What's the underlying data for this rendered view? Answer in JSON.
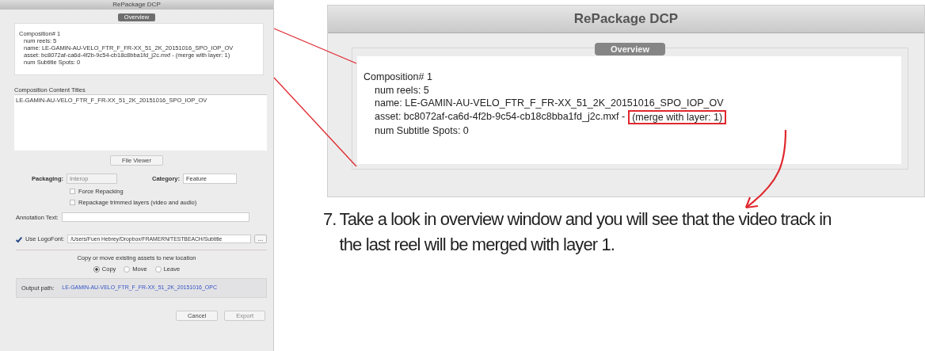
{
  "left_dialog": {
    "title": "RePackage DCP",
    "tab": {
      "label": "Overview",
      "selected": true
    },
    "composition": {
      "title": "Composition# 1",
      "children": [
        {
          "text": "num reels:  5"
        },
        {
          "text": "name:  LE-GAMIN-AU-VELO_FTR_F_FR-XX_51_2K_20151016_SPO_IOP_OV"
        },
        {
          "text": "asset: bc8072af-ca6d-4f2b-9c54-cb18c8bba1fd_j2c.mxf - (merge with layer: 1)"
        },
        {
          "text": "num Subtitle Spots: 0"
        }
      ]
    },
    "content_titles": {
      "heading": "Composition Content Titles",
      "items": [
        "LE-GAMIN-AU-VELO_FTR_F_FR-XX_51_2K_20151016_SPO_IOP_OV"
      ]
    },
    "file_viewer_button": "File Viewer",
    "packaging": {
      "label": "Packaging:",
      "value": "Interop",
      "disabled": true
    },
    "category": {
      "label": "Category:",
      "value": "Feature",
      "disabled": false
    },
    "options": [
      {
        "label": "Force Repacking",
        "checked": false
      },
      {
        "label": "Repackage trimmed layers (video and audio)",
        "checked": false
      }
    ],
    "annotation_text": {
      "label": "Annotation Text:"
    },
    "logo_font": {
      "label": "Use LogoFont:",
      "checked": true,
      "value": "/Users/Fuen Hebrey/Dropbox/FRAMERN/TESTBEACH/Subtitle",
      "browse": "..."
    },
    "copy_move": {
      "prompt": "Copy or move existing assets to new location",
      "options": [
        {
          "label": "Copy",
          "selected": true
        },
        {
          "label": "Move",
          "selected": false
        },
        {
          "label": "Leave",
          "selected": false
        }
      ]
    },
    "output_path": {
      "label": "Output path:",
      "value": "LE-GAMIN-AU-VELO_FTR_F_FR-XX_51_2K_20151016_OPC"
    },
    "buttons": [
      {
        "label": "Cancel",
        "disabled": false
      },
      {
        "label": "Export",
        "disabled": true
      }
    ]
  },
  "zoom_view": {
    "title": "RePackage DCP",
    "tab": {
      "label": "Overview",
      "selected": true
    },
    "composition": {
      "title": "Composition# 1",
      "children": [
        {
          "text": "num reels:  5"
        },
        {
          "text": "name:  LE-GAMIN-AU-VELO_FTR_F_FR-XX_51_2K_20151016_SPO_IOP_OV"
        },
        {
          "text": "asset: bc8072af-ca6d-4f2b-9c54-cb18c8bba1fd_j2c.mxf -",
          "highlight": "(merge with layer: 1)"
        },
        {
          "text": "num Subtitle Spots: 0"
        }
      ]
    }
  },
  "instruction": {
    "number": "7.",
    "text": "Take a look in overview window and you will see that the video track in the last reel will be merged with layer 1."
  }
}
